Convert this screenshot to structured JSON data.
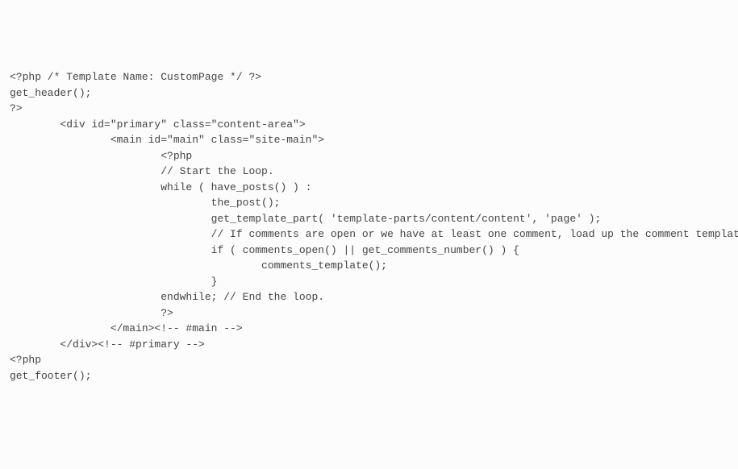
{
  "code": {
    "lines": [
      "<?php /* Template Name: CustomPage */ ?>",
      "",
      "get_header();",
      "?>",
      "",
      "        <div id=\"primary\" class=\"content-area\">",
      "                <main id=\"main\" class=\"site-main\">",
      "",
      "                        <?php",
      "",
      "                        // Start the Loop.",
      "                        while ( have_posts() ) :",
      "                                the_post();",
      "",
      "                                get_template_part( 'template-parts/content/content', 'page' );",
      "",
      "                                // If comments are open or we have at least one comment, load up the comment template.",
      "                                if ( comments_open() || get_comments_number() ) {",
      "                                        comments_template();",
      "                                }",
      "",
      "                        endwhile; // End the loop.",
      "                        ?>",
      "",
      "                </main><!-- #main -->",
      "        </div><!-- #primary -->",
      "",
      "<?php",
      "get_footer();"
    ]
  }
}
